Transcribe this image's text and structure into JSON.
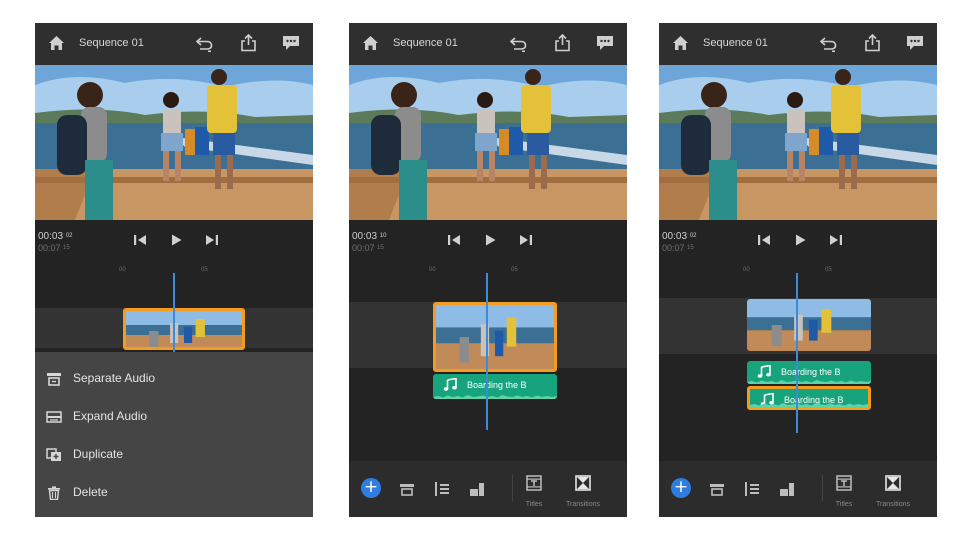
{
  "screens": [
    {
      "sequence_title": "Sequence 01",
      "timecode_current": "00:03",
      "timecode_current_frames": "02",
      "timecode_total": "00:07",
      "timecode_total_frames": "15",
      "ruler_labels": [
        "00",
        "05"
      ],
      "context_menu": [
        {
          "label": "Separate Audio",
          "icon": "separate-audio-icon"
        },
        {
          "label": "Expand Audio",
          "icon": "expand-audio-icon"
        },
        {
          "label": "Duplicate",
          "icon": "duplicate-icon"
        },
        {
          "label": "Delete",
          "icon": "trash-icon"
        }
      ]
    },
    {
      "sequence_title": "Sequence 01",
      "timecode_current": "00:03",
      "timecode_current_frames": "10",
      "timecode_total": "00:07",
      "timecode_total_frames": "15",
      "ruler_labels": [
        "00",
        "05"
      ],
      "audio_clip_label": "Boarding the B",
      "toolbar": {
        "titles_label": "Titles",
        "transitions_label": "Transitions"
      }
    },
    {
      "sequence_title": "Sequence 01",
      "timecode_current": "00:03",
      "timecode_current_frames": "02",
      "timecode_total": "00:07",
      "timecode_total_frames": "15",
      "ruler_labels": [
        "00",
        "05"
      ],
      "audio_clip_label_1": "Boarding the B",
      "audio_clip_label_2": "Boarding the B",
      "toolbar": {
        "titles_label": "Titles",
        "transitions_label": "Transitions"
      }
    }
  ],
  "colors": {
    "accent_orange": "#f39c1f",
    "audio_green": "#17a37c",
    "playhead_blue": "#3f8ad7",
    "add_button_blue": "#2f7de1"
  }
}
